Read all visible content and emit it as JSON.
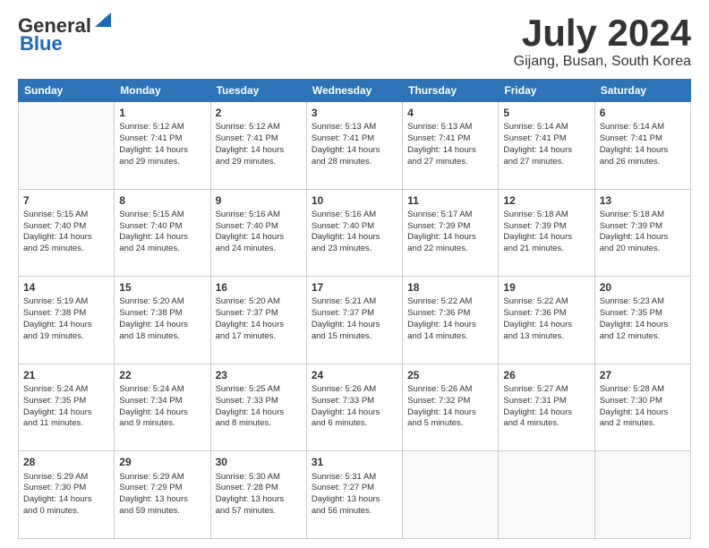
{
  "header": {
    "logo_general": "General",
    "logo_blue": "Blue",
    "month_title": "July 2024",
    "location": "Gijang, Busan, South Korea"
  },
  "days_of_week": [
    "Sunday",
    "Monday",
    "Tuesday",
    "Wednesday",
    "Thursday",
    "Friday",
    "Saturday"
  ],
  "weeks": [
    [
      {
        "day": "",
        "data": []
      },
      {
        "day": "1",
        "data": [
          "Sunrise: 5:12 AM",
          "Sunset: 7:41 PM",
          "Daylight: 14 hours",
          "and 29 minutes."
        ]
      },
      {
        "day": "2",
        "data": [
          "Sunrise: 5:12 AM",
          "Sunset: 7:41 PM",
          "Daylight: 14 hours",
          "and 29 minutes."
        ]
      },
      {
        "day": "3",
        "data": [
          "Sunrise: 5:13 AM",
          "Sunset: 7:41 PM",
          "Daylight: 14 hours",
          "and 28 minutes."
        ]
      },
      {
        "day": "4",
        "data": [
          "Sunrise: 5:13 AM",
          "Sunset: 7:41 PM",
          "Daylight: 14 hours",
          "and 27 minutes."
        ]
      },
      {
        "day": "5",
        "data": [
          "Sunrise: 5:14 AM",
          "Sunset: 7:41 PM",
          "Daylight: 14 hours",
          "and 27 minutes."
        ]
      },
      {
        "day": "6",
        "data": [
          "Sunrise: 5:14 AM",
          "Sunset: 7:41 PM",
          "Daylight: 14 hours",
          "and 26 minutes."
        ]
      }
    ],
    [
      {
        "day": "7",
        "data": [
          "Sunrise: 5:15 AM",
          "Sunset: 7:40 PM",
          "Daylight: 14 hours",
          "and 25 minutes."
        ]
      },
      {
        "day": "8",
        "data": [
          "Sunrise: 5:15 AM",
          "Sunset: 7:40 PM",
          "Daylight: 14 hours",
          "and 24 minutes."
        ]
      },
      {
        "day": "9",
        "data": [
          "Sunrise: 5:16 AM",
          "Sunset: 7:40 PM",
          "Daylight: 14 hours",
          "and 24 minutes."
        ]
      },
      {
        "day": "10",
        "data": [
          "Sunrise: 5:16 AM",
          "Sunset: 7:40 PM",
          "Daylight: 14 hours",
          "and 23 minutes."
        ]
      },
      {
        "day": "11",
        "data": [
          "Sunrise: 5:17 AM",
          "Sunset: 7:39 PM",
          "Daylight: 14 hours",
          "and 22 minutes."
        ]
      },
      {
        "day": "12",
        "data": [
          "Sunrise: 5:18 AM",
          "Sunset: 7:39 PM",
          "Daylight: 14 hours",
          "and 21 minutes."
        ]
      },
      {
        "day": "13",
        "data": [
          "Sunrise: 5:18 AM",
          "Sunset: 7:39 PM",
          "Daylight: 14 hours",
          "and 20 minutes."
        ]
      }
    ],
    [
      {
        "day": "14",
        "data": [
          "Sunrise: 5:19 AM",
          "Sunset: 7:38 PM",
          "Daylight: 14 hours",
          "and 19 minutes."
        ]
      },
      {
        "day": "15",
        "data": [
          "Sunrise: 5:20 AM",
          "Sunset: 7:38 PM",
          "Daylight: 14 hours",
          "and 18 minutes."
        ]
      },
      {
        "day": "16",
        "data": [
          "Sunrise: 5:20 AM",
          "Sunset: 7:37 PM",
          "Daylight: 14 hours",
          "and 17 minutes."
        ]
      },
      {
        "day": "17",
        "data": [
          "Sunrise: 5:21 AM",
          "Sunset: 7:37 PM",
          "Daylight: 14 hours",
          "and 15 minutes."
        ]
      },
      {
        "day": "18",
        "data": [
          "Sunrise: 5:22 AM",
          "Sunset: 7:36 PM",
          "Daylight: 14 hours",
          "and 14 minutes."
        ]
      },
      {
        "day": "19",
        "data": [
          "Sunrise: 5:22 AM",
          "Sunset: 7:36 PM",
          "Daylight: 14 hours",
          "and 13 minutes."
        ]
      },
      {
        "day": "20",
        "data": [
          "Sunrise: 5:23 AM",
          "Sunset: 7:35 PM",
          "Daylight: 14 hours",
          "and 12 minutes."
        ]
      }
    ],
    [
      {
        "day": "21",
        "data": [
          "Sunrise: 5:24 AM",
          "Sunset: 7:35 PM",
          "Daylight: 14 hours",
          "and 11 minutes."
        ]
      },
      {
        "day": "22",
        "data": [
          "Sunrise: 5:24 AM",
          "Sunset: 7:34 PM",
          "Daylight: 14 hours",
          "and 9 minutes."
        ]
      },
      {
        "day": "23",
        "data": [
          "Sunrise: 5:25 AM",
          "Sunset: 7:33 PM",
          "Daylight: 14 hours",
          "and 8 minutes."
        ]
      },
      {
        "day": "24",
        "data": [
          "Sunrise: 5:26 AM",
          "Sunset: 7:33 PM",
          "Daylight: 14 hours",
          "and 6 minutes."
        ]
      },
      {
        "day": "25",
        "data": [
          "Sunrise: 5:26 AM",
          "Sunset: 7:32 PM",
          "Daylight: 14 hours",
          "and 5 minutes."
        ]
      },
      {
        "day": "26",
        "data": [
          "Sunrise: 5:27 AM",
          "Sunset: 7:31 PM",
          "Daylight: 14 hours",
          "and 4 minutes."
        ]
      },
      {
        "day": "27",
        "data": [
          "Sunrise: 5:28 AM",
          "Sunset: 7:30 PM",
          "Daylight: 14 hours",
          "and 2 minutes."
        ]
      }
    ],
    [
      {
        "day": "28",
        "data": [
          "Sunrise: 5:29 AM",
          "Sunset: 7:30 PM",
          "Daylight: 14 hours",
          "and 0 minutes."
        ]
      },
      {
        "day": "29",
        "data": [
          "Sunrise: 5:29 AM",
          "Sunset: 7:29 PM",
          "Daylight: 13 hours",
          "and 59 minutes."
        ]
      },
      {
        "day": "30",
        "data": [
          "Sunrise: 5:30 AM",
          "Sunset: 7:28 PM",
          "Daylight: 13 hours",
          "and 57 minutes."
        ]
      },
      {
        "day": "31",
        "data": [
          "Sunrise: 5:31 AM",
          "Sunset: 7:27 PM",
          "Daylight: 13 hours",
          "and 56 minutes."
        ]
      },
      {
        "day": "",
        "data": []
      },
      {
        "day": "",
        "data": []
      },
      {
        "day": "",
        "data": []
      }
    ]
  ]
}
